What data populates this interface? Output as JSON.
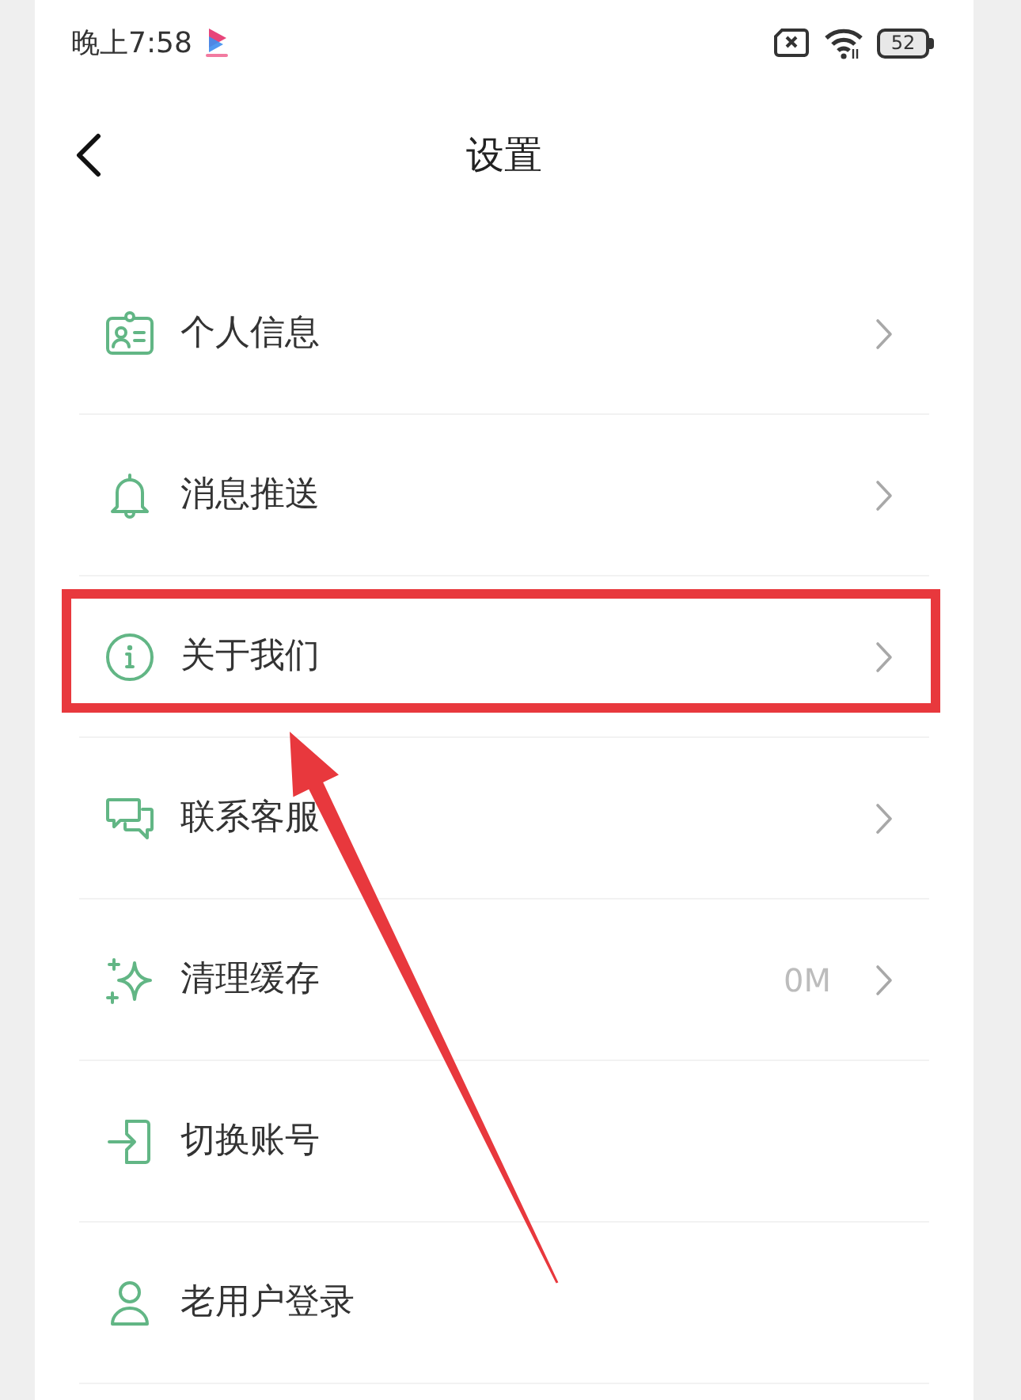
{
  "status_bar": {
    "time": "晚上7:58",
    "battery": "52"
  },
  "header": {
    "title": "设置"
  },
  "items": [
    {
      "label": "个人信息",
      "chevron": true,
      "highlighted": false
    },
    {
      "label": "消息推送",
      "chevron": true,
      "highlighted": false
    },
    {
      "label": "关于我们",
      "chevron": true,
      "highlighted": true
    },
    {
      "label": "联系客服",
      "chevron": true,
      "highlighted": false
    },
    {
      "label": "清理缓存",
      "value": "0M",
      "chevron": true,
      "highlighted": false
    },
    {
      "label": "切换账号",
      "chevron": false,
      "highlighted": false
    },
    {
      "label": "老用户登录",
      "chevron": false,
      "highlighted": false
    }
  ]
}
